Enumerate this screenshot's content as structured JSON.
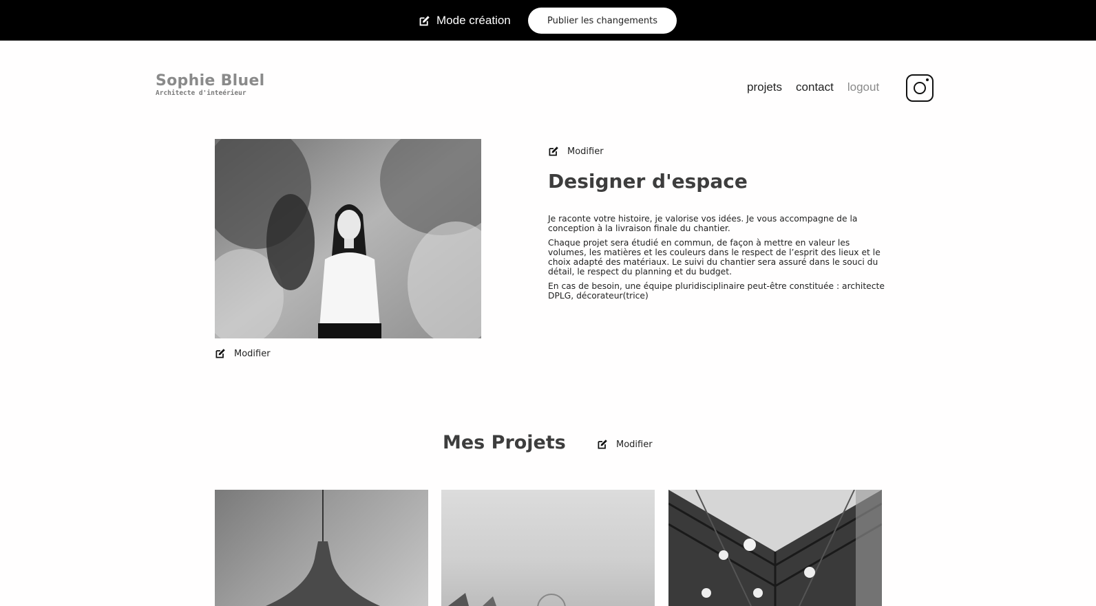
{
  "edit_bar": {
    "mode_label": "Mode création",
    "publish_label": "Publier les changements"
  },
  "header": {
    "logo_name": "Sophie Bluel",
    "logo_subtitle": "Architecte d'inteérieur",
    "nav": [
      {
        "label": "projets"
      },
      {
        "label": "contact"
      },
      {
        "label": "logout"
      }
    ],
    "instagram_icon": "instagram-icon"
  },
  "introduction": {
    "modify_label": "Modifier",
    "title": "Designer d'espace",
    "paragraphs": [
      "Je raconte votre histoire, je valorise vos idées. Je vous accompagne de la conception à la livraison finale du chantier.",
      "Chaque projet sera étudié en commun, de façon à mettre en valeur les volumes, les matières et les couleurs dans le respect de l’esprit des lieux et le choix adapté des matériaux. Le suivi du chantier sera assuré dans le souci du détail, le respect du planning et du budget.",
      "En cas de besoin, une équipe pluridisciplinaire peut-être constituée : architecte DPLG, décorateur(trice)"
    ],
    "portrait_modify_label": "Modifier"
  },
  "projects": {
    "title": "Mes Projets",
    "modify_label": "Modifier"
  },
  "colors": {
    "bar_background": "#000000",
    "page_background": "#fffefe",
    "title_text": "#3d3d3d",
    "logo_text": "#8a8a8a"
  }
}
